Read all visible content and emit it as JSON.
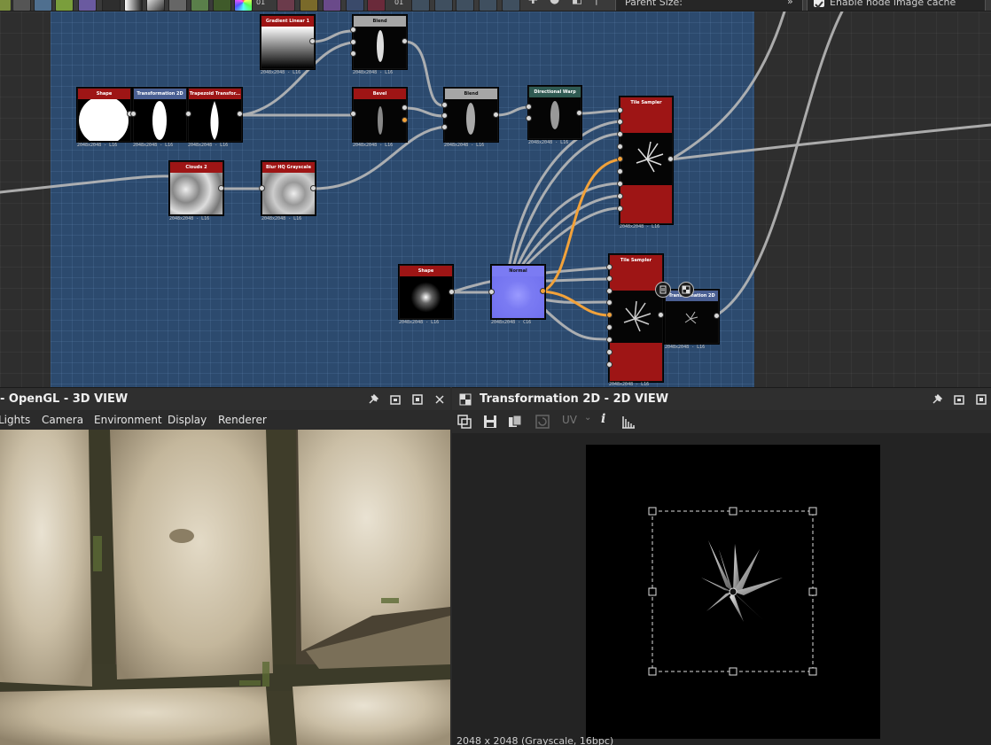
{
  "toolbar": {
    "counter_1": "01",
    "counter_2": "01",
    "parent_size_label": "Parent Size:",
    "more_glyph": "»",
    "cache_label": "Enable node image cache",
    "cache_checked": true
  },
  "graph": {
    "nodes": [
      {
        "id": "gradient",
        "title": "Gradient Linear 1",
        "footer": "2048x2048 - L16"
      },
      {
        "id": "blend1",
        "title": "Blend",
        "footer": "2048x2048 - L16"
      },
      {
        "id": "shape1",
        "title": "Shape",
        "footer": "2048x2048 - L16"
      },
      {
        "id": "transform1",
        "title": "Transformation 2D",
        "footer": "2048x2048 - L16"
      },
      {
        "id": "trapezoid",
        "title": "Trapezoid Transfor...",
        "footer": "2048x2048 - L16"
      },
      {
        "id": "bevel",
        "title": "Bevel",
        "footer": "2048x2048 - L16"
      },
      {
        "id": "blend2",
        "title": "Blend",
        "footer": "2048x2048 - L16"
      },
      {
        "id": "warp",
        "title": "Directional Warp",
        "footer": "2048x2048 - L16"
      },
      {
        "id": "tile1",
        "title": "Tile Sampler",
        "footer": "2048x2048 - L16"
      },
      {
        "id": "clouds",
        "title": "Clouds 2",
        "footer": "2048x2048 - L16"
      },
      {
        "id": "blur",
        "title": "Blur HQ Grayscale",
        "footer": "2048x2048 - L16"
      },
      {
        "id": "shape2",
        "title": "Shape",
        "footer": "2048x2048 - L16"
      },
      {
        "id": "normal",
        "title": "Normal",
        "footer": "2048x2048 - C16"
      },
      {
        "id": "tile2",
        "title": "Tile Sampler",
        "footer": "2048x2048 - L16"
      },
      {
        "id": "transform2",
        "title": "Transformation 2D",
        "footer": "2048x2048 - L16"
      }
    ]
  },
  "view3d": {
    "title": "- OpenGL - 3D VIEW",
    "menu": [
      "Lights",
      "Camera",
      "Environment",
      "Display",
      "Renderer"
    ]
  },
  "view2d": {
    "title": "Transformation 2D - 2D VIEW",
    "uv_label": "UV",
    "status": "2048 x 2048 (Grayscale, 16bpc)"
  },
  "colors": {
    "frame": "#2c4a6e",
    "node_header_red": "#9e1515",
    "node_header_blue": "#4a5f93",
    "node_header_gray": "#a6a6a6",
    "node_header_teal": "#2f5a52",
    "normal_node": "#7b7bf3",
    "wire": "#b9b9b9",
    "wire_orange": "#f2a23a"
  }
}
